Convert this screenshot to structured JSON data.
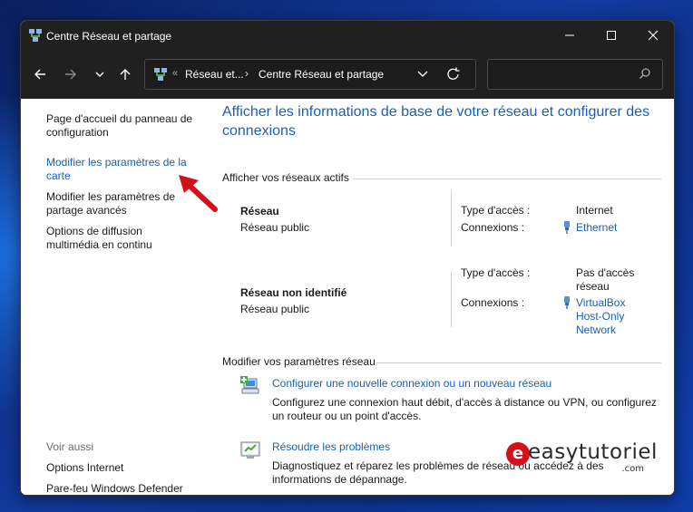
{
  "window": {
    "title": "Centre Réseau et partage"
  },
  "address": {
    "overflow": "«",
    "crumb1": "Réseau et...",
    "separator": "›",
    "crumb2": "Centre Réseau et partage"
  },
  "sidebar": {
    "home_link": "Page d'accueil du panneau de configuration",
    "adapter_link": "Modifier les paramètres de la carte",
    "sharing_link": "Modifier les paramètres de partage avancés",
    "streaming_link": "Options de diffusion multimédia en continu",
    "see_also": "Voir aussi",
    "internet_options": "Options Internet",
    "firewall": "Pare-feu Windows Defender"
  },
  "main": {
    "title": "Afficher les informations de base de votre réseau et configurer des connexions",
    "active_label": "Afficher vos réseaux actifs",
    "networks": [
      {
        "name": "Réseau",
        "type": "Réseau public",
        "access_label": "Type d'accès :",
        "access_value": "Internet",
        "conn_label": "Connexions :",
        "conn_value": "Ethernet"
      },
      {
        "name": "Réseau non identifié",
        "type": "Réseau public",
        "access_label": "Type d'accès :",
        "access_value": "Pas d'accès réseau",
        "conn_label": "Connexions :",
        "conn_value": "VirtualBox Host-Only Network"
      }
    ],
    "change_label": "Modifier vos paramètres réseau",
    "tasks": [
      {
        "title": "Configurer une nouvelle connexion ou un nouveau réseau",
        "desc": "Configurez une connexion haut débit, d'accès à distance ou VPN, ou configurez un routeur ou un point d'accès."
      },
      {
        "title": "Résoudre les problèmes",
        "desc": "Diagnostiquez et réparez les problèmes de réseau ou accédez à des informations de dépannage."
      }
    ]
  },
  "watermark": {
    "e": "e",
    "text": "easytutoriel",
    "suffix": ".com"
  },
  "colors": {
    "link": "#1a5fb4",
    "titlebar": "#202020",
    "arrow": "#d4111a"
  }
}
